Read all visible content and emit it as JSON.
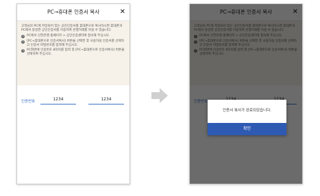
{
  "dialog_title": "PC→휴대폰 인증서 복사",
  "close_symbol": "✕",
  "intro": "고객님의 PC에 저장되어 있는 공인인증서를 휴대폰으로 복사하시면 휴대폰과 PC에서 동일한 공인인증서를 이용하여 은행거래를 하실 수 있습니다.",
  "steps": [
    {
      "num": "1",
      "text": "PC에서 신한은행 홈페이지 > 공인인증센터에 접속해 주십시오."
    },
    {
      "num": "2",
      "text": "[PC→휴대폰으로 인증서복사] 버튼을 선택한 후 사용하실 인증서를 선택하고 인증서 비밀번호를 입력해 주십시오."
    },
    {
      "num": "3",
      "text": "PC화면에 인증번호 8자리를 입력 후 [PC→휴대폰으로 인증서복사] 버튼을 선택하여 주십시오."
    }
  ],
  "cert": {
    "label": "인증번호",
    "code1": "1234",
    "code2": "1234"
  },
  "popup": {
    "message": "인증서 복사가 완료되었습니다.",
    "confirm": "확인"
  },
  "colors": {
    "accent": "#3a72c8",
    "button": "#2e5ab3",
    "info_bg": "#f6f2e9"
  }
}
